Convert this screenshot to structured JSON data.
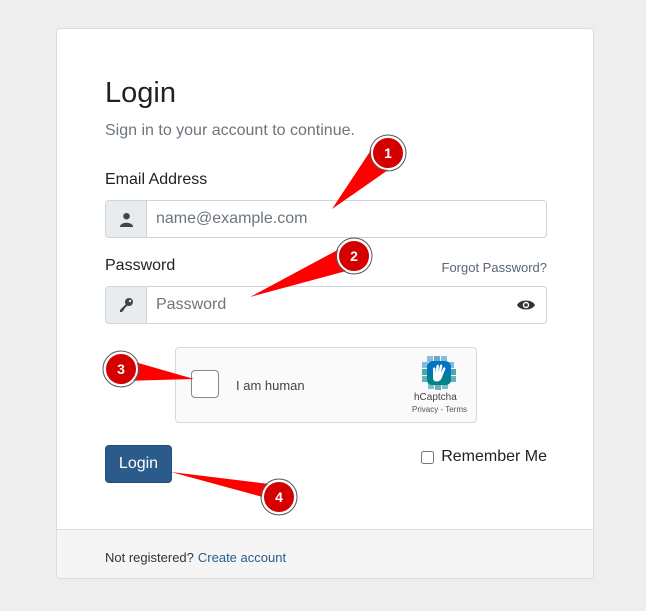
{
  "login": {
    "title": "Login",
    "subtitle": "Sign in to your account to continue.",
    "email_label": "Email Address",
    "email_placeholder": "name@example.com",
    "password_label": "Password",
    "password_placeholder": "Password",
    "forgot_link": "Forgot Password?",
    "login_button": "Login",
    "remember_label": "Remember Me"
  },
  "captcha": {
    "label": "I am human",
    "brand": "hCaptcha",
    "privacy": "Privacy",
    "separator": " - ",
    "terms": "Terms"
  },
  "footer": {
    "text": "Not registered?",
    "link": "Create account"
  },
  "annotations": {
    "markers": [
      "1",
      "2",
      "3",
      "4"
    ],
    "color": "#ff0000"
  }
}
